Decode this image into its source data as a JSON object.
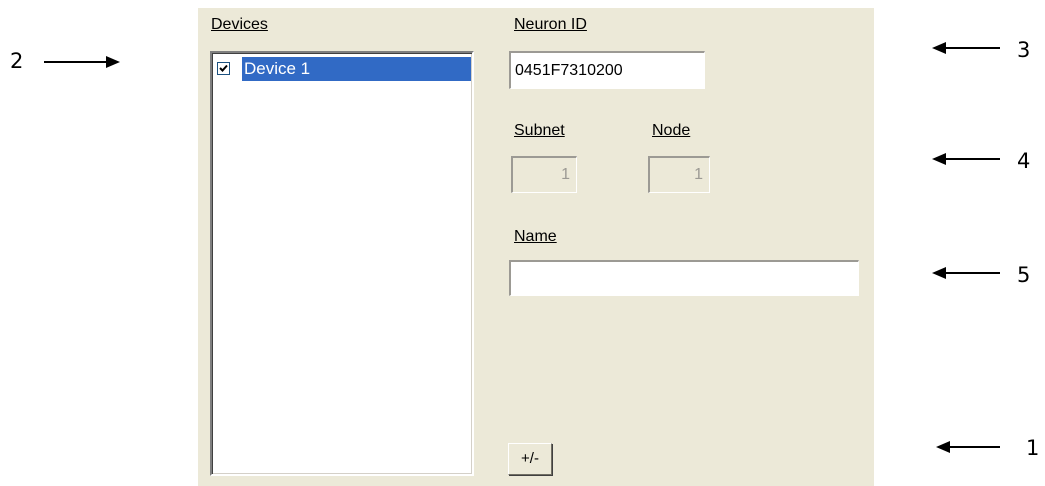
{
  "devices": {
    "label": "Devices",
    "items": [
      {
        "label": "Device 1",
        "checked": true,
        "selected": true
      }
    ]
  },
  "neuron_id": {
    "label": "Neuron ID",
    "value": "0451F7310200"
  },
  "subnet": {
    "label": "Subnet",
    "value": "1"
  },
  "node": {
    "label": "Node",
    "value": "1"
  },
  "name": {
    "label": "Name",
    "value": ""
  },
  "toggle_button": {
    "label": "+/-"
  },
  "callouts": {
    "c1": "1",
    "c2": "2",
    "c3": "3",
    "c4": "4",
    "c5": "5"
  },
  "colors": {
    "panel": "#ece9d8",
    "selection": "#316ac5"
  }
}
